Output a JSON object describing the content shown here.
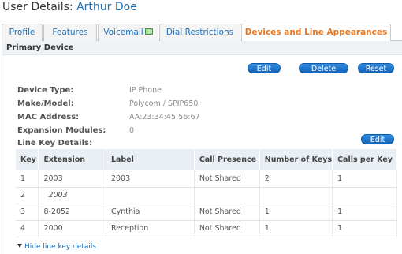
{
  "page": {
    "title_prefix": "User Details:",
    "user_name": "Arthur Doe"
  },
  "tabs": [
    {
      "label": "Profile",
      "active": false
    },
    {
      "label": "Features",
      "active": false
    },
    {
      "label": "Voicemail",
      "active": false,
      "icon": "voicemail-status-icon"
    },
    {
      "label": "Dial Restrictions",
      "active": false
    },
    {
      "label": "Devices and Line Appearances",
      "active": true
    }
  ],
  "primary_device": {
    "header": "Primary Device",
    "buttons": {
      "edit": "Edit",
      "delete": "Delete",
      "reset": "Reset"
    },
    "fields": [
      {
        "label": "Device Type:",
        "value": "IP Phone"
      },
      {
        "label": "Make/Model:",
        "value": "Polycom / SPIP650"
      },
      {
        "label": "MAC Address:",
        "value": "AA:23:34:45:56:67"
      },
      {
        "label": "Expansion Modules:",
        "value": "0"
      }
    ]
  },
  "line_keys": {
    "title": "Line Key Details:",
    "edit_label": "Edit",
    "columns": [
      "Key",
      "Extension",
      "Label",
      "Call Presence",
      "Number of Keys",
      "Calls per Key"
    ],
    "rows": [
      [
        "1",
        "2003",
        "2003",
        "Not Shared",
        "2",
        "1"
      ],
      [
        "2",
        "2003",
        "",
        "",
        "",
        ""
      ],
      [
        "3",
        "8-2052",
        "Cynthia",
        "Not Shared",
        "1",
        "1"
      ],
      [
        "4",
        "2000",
        "Reception",
        "Not Shared",
        "1",
        "1"
      ]
    ],
    "hide_link": "Hide line key details"
  },
  "colors": {
    "accent": "#1f6fb5",
    "active_tab": "#e87722",
    "button": "#1e74c8"
  }
}
